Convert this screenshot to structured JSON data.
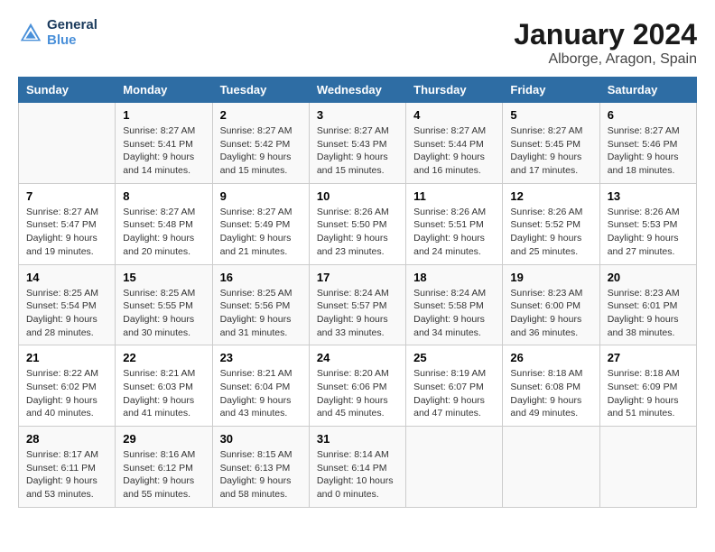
{
  "logo": {
    "text_general": "General",
    "text_blue": "Blue"
  },
  "title": "January 2024",
  "subtitle": "Alborge, Aragon, Spain",
  "header_days": [
    "Sunday",
    "Monday",
    "Tuesday",
    "Wednesday",
    "Thursday",
    "Friday",
    "Saturday"
  ],
  "weeks": [
    [
      {
        "day": "",
        "sunrise": "",
        "sunset": "",
        "daylight": ""
      },
      {
        "day": "1",
        "sunrise": "Sunrise: 8:27 AM",
        "sunset": "Sunset: 5:41 PM",
        "daylight": "Daylight: 9 hours and 14 minutes."
      },
      {
        "day": "2",
        "sunrise": "Sunrise: 8:27 AM",
        "sunset": "Sunset: 5:42 PM",
        "daylight": "Daylight: 9 hours and 15 minutes."
      },
      {
        "day": "3",
        "sunrise": "Sunrise: 8:27 AM",
        "sunset": "Sunset: 5:43 PM",
        "daylight": "Daylight: 9 hours and 15 minutes."
      },
      {
        "day": "4",
        "sunrise": "Sunrise: 8:27 AM",
        "sunset": "Sunset: 5:44 PM",
        "daylight": "Daylight: 9 hours and 16 minutes."
      },
      {
        "day": "5",
        "sunrise": "Sunrise: 8:27 AM",
        "sunset": "Sunset: 5:45 PM",
        "daylight": "Daylight: 9 hours and 17 minutes."
      },
      {
        "day": "6",
        "sunrise": "Sunrise: 8:27 AM",
        "sunset": "Sunset: 5:46 PM",
        "daylight": "Daylight: 9 hours and 18 minutes."
      }
    ],
    [
      {
        "day": "7",
        "sunrise": "Sunrise: 8:27 AM",
        "sunset": "Sunset: 5:47 PM",
        "daylight": "Daylight: 9 hours and 19 minutes."
      },
      {
        "day": "8",
        "sunrise": "Sunrise: 8:27 AM",
        "sunset": "Sunset: 5:48 PM",
        "daylight": "Daylight: 9 hours and 20 minutes."
      },
      {
        "day": "9",
        "sunrise": "Sunrise: 8:27 AM",
        "sunset": "Sunset: 5:49 PM",
        "daylight": "Daylight: 9 hours and 21 minutes."
      },
      {
        "day": "10",
        "sunrise": "Sunrise: 8:26 AM",
        "sunset": "Sunset: 5:50 PM",
        "daylight": "Daylight: 9 hours and 23 minutes."
      },
      {
        "day": "11",
        "sunrise": "Sunrise: 8:26 AM",
        "sunset": "Sunset: 5:51 PM",
        "daylight": "Daylight: 9 hours and 24 minutes."
      },
      {
        "day": "12",
        "sunrise": "Sunrise: 8:26 AM",
        "sunset": "Sunset: 5:52 PM",
        "daylight": "Daylight: 9 hours and 25 minutes."
      },
      {
        "day": "13",
        "sunrise": "Sunrise: 8:26 AM",
        "sunset": "Sunset: 5:53 PM",
        "daylight": "Daylight: 9 hours and 27 minutes."
      }
    ],
    [
      {
        "day": "14",
        "sunrise": "Sunrise: 8:25 AM",
        "sunset": "Sunset: 5:54 PM",
        "daylight": "Daylight: 9 hours and 28 minutes."
      },
      {
        "day": "15",
        "sunrise": "Sunrise: 8:25 AM",
        "sunset": "Sunset: 5:55 PM",
        "daylight": "Daylight: 9 hours and 30 minutes."
      },
      {
        "day": "16",
        "sunrise": "Sunrise: 8:25 AM",
        "sunset": "Sunset: 5:56 PM",
        "daylight": "Daylight: 9 hours and 31 minutes."
      },
      {
        "day": "17",
        "sunrise": "Sunrise: 8:24 AM",
        "sunset": "Sunset: 5:57 PM",
        "daylight": "Daylight: 9 hours and 33 minutes."
      },
      {
        "day": "18",
        "sunrise": "Sunrise: 8:24 AM",
        "sunset": "Sunset: 5:58 PM",
        "daylight": "Daylight: 9 hours and 34 minutes."
      },
      {
        "day": "19",
        "sunrise": "Sunrise: 8:23 AM",
        "sunset": "Sunset: 6:00 PM",
        "daylight": "Daylight: 9 hours and 36 minutes."
      },
      {
        "day": "20",
        "sunrise": "Sunrise: 8:23 AM",
        "sunset": "Sunset: 6:01 PM",
        "daylight": "Daylight: 9 hours and 38 minutes."
      }
    ],
    [
      {
        "day": "21",
        "sunrise": "Sunrise: 8:22 AM",
        "sunset": "Sunset: 6:02 PM",
        "daylight": "Daylight: 9 hours and 40 minutes."
      },
      {
        "day": "22",
        "sunrise": "Sunrise: 8:21 AM",
        "sunset": "Sunset: 6:03 PM",
        "daylight": "Daylight: 9 hours and 41 minutes."
      },
      {
        "day": "23",
        "sunrise": "Sunrise: 8:21 AM",
        "sunset": "Sunset: 6:04 PM",
        "daylight": "Daylight: 9 hours and 43 minutes."
      },
      {
        "day": "24",
        "sunrise": "Sunrise: 8:20 AM",
        "sunset": "Sunset: 6:06 PM",
        "daylight": "Daylight: 9 hours and 45 minutes."
      },
      {
        "day": "25",
        "sunrise": "Sunrise: 8:19 AM",
        "sunset": "Sunset: 6:07 PM",
        "daylight": "Daylight: 9 hours and 47 minutes."
      },
      {
        "day": "26",
        "sunrise": "Sunrise: 8:18 AM",
        "sunset": "Sunset: 6:08 PM",
        "daylight": "Daylight: 9 hours and 49 minutes."
      },
      {
        "day": "27",
        "sunrise": "Sunrise: 8:18 AM",
        "sunset": "Sunset: 6:09 PM",
        "daylight": "Daylight: 9 hours and 51 minutes."
      }
    ],
    [
      {
        "day": "28",
        "sunrise": "Sunrise: 8:17 AM",
        "sunset": "Sunset: 6:11 PM",
        "daylight": "Daylight: 9 hours and 53 minutes."
      },
      {
        "day": "29",
        "sunrise": "Sunrise: 8:16 AM",
        "sunset": "Sunset: 6:12 PM",
        "daylight": "Daylight: 9 hours and 55 minutes."
      },
      {
        "day": "30",
        "sunrise": "Sunrise: 8:15 AM",
        "sunset": "Sunset: 6:13 PM",
        "daylight": "Daylight: 9 hours and 58 minutes."
      },
      {
        "day": "31",
        "sunrise": "Sunrise: 8:14 AM",
        "sunset": "Sunset: 6:14 PM",
        "daylight": "Daylight: 10 hours and 0 minutes."
      },
      {
        "day": "",
        "sunrise": "",
        "sunset": "",
        "daylight": ""
      },
      {
        "day": "",
        "sunrise": "",
        "sunset": "",
        "daylight": ""
      },
      {
        "day": "",
        "sunrise": "",
        "sunset": "",
        "daylight": ""
      }
    ]
  ]
}
